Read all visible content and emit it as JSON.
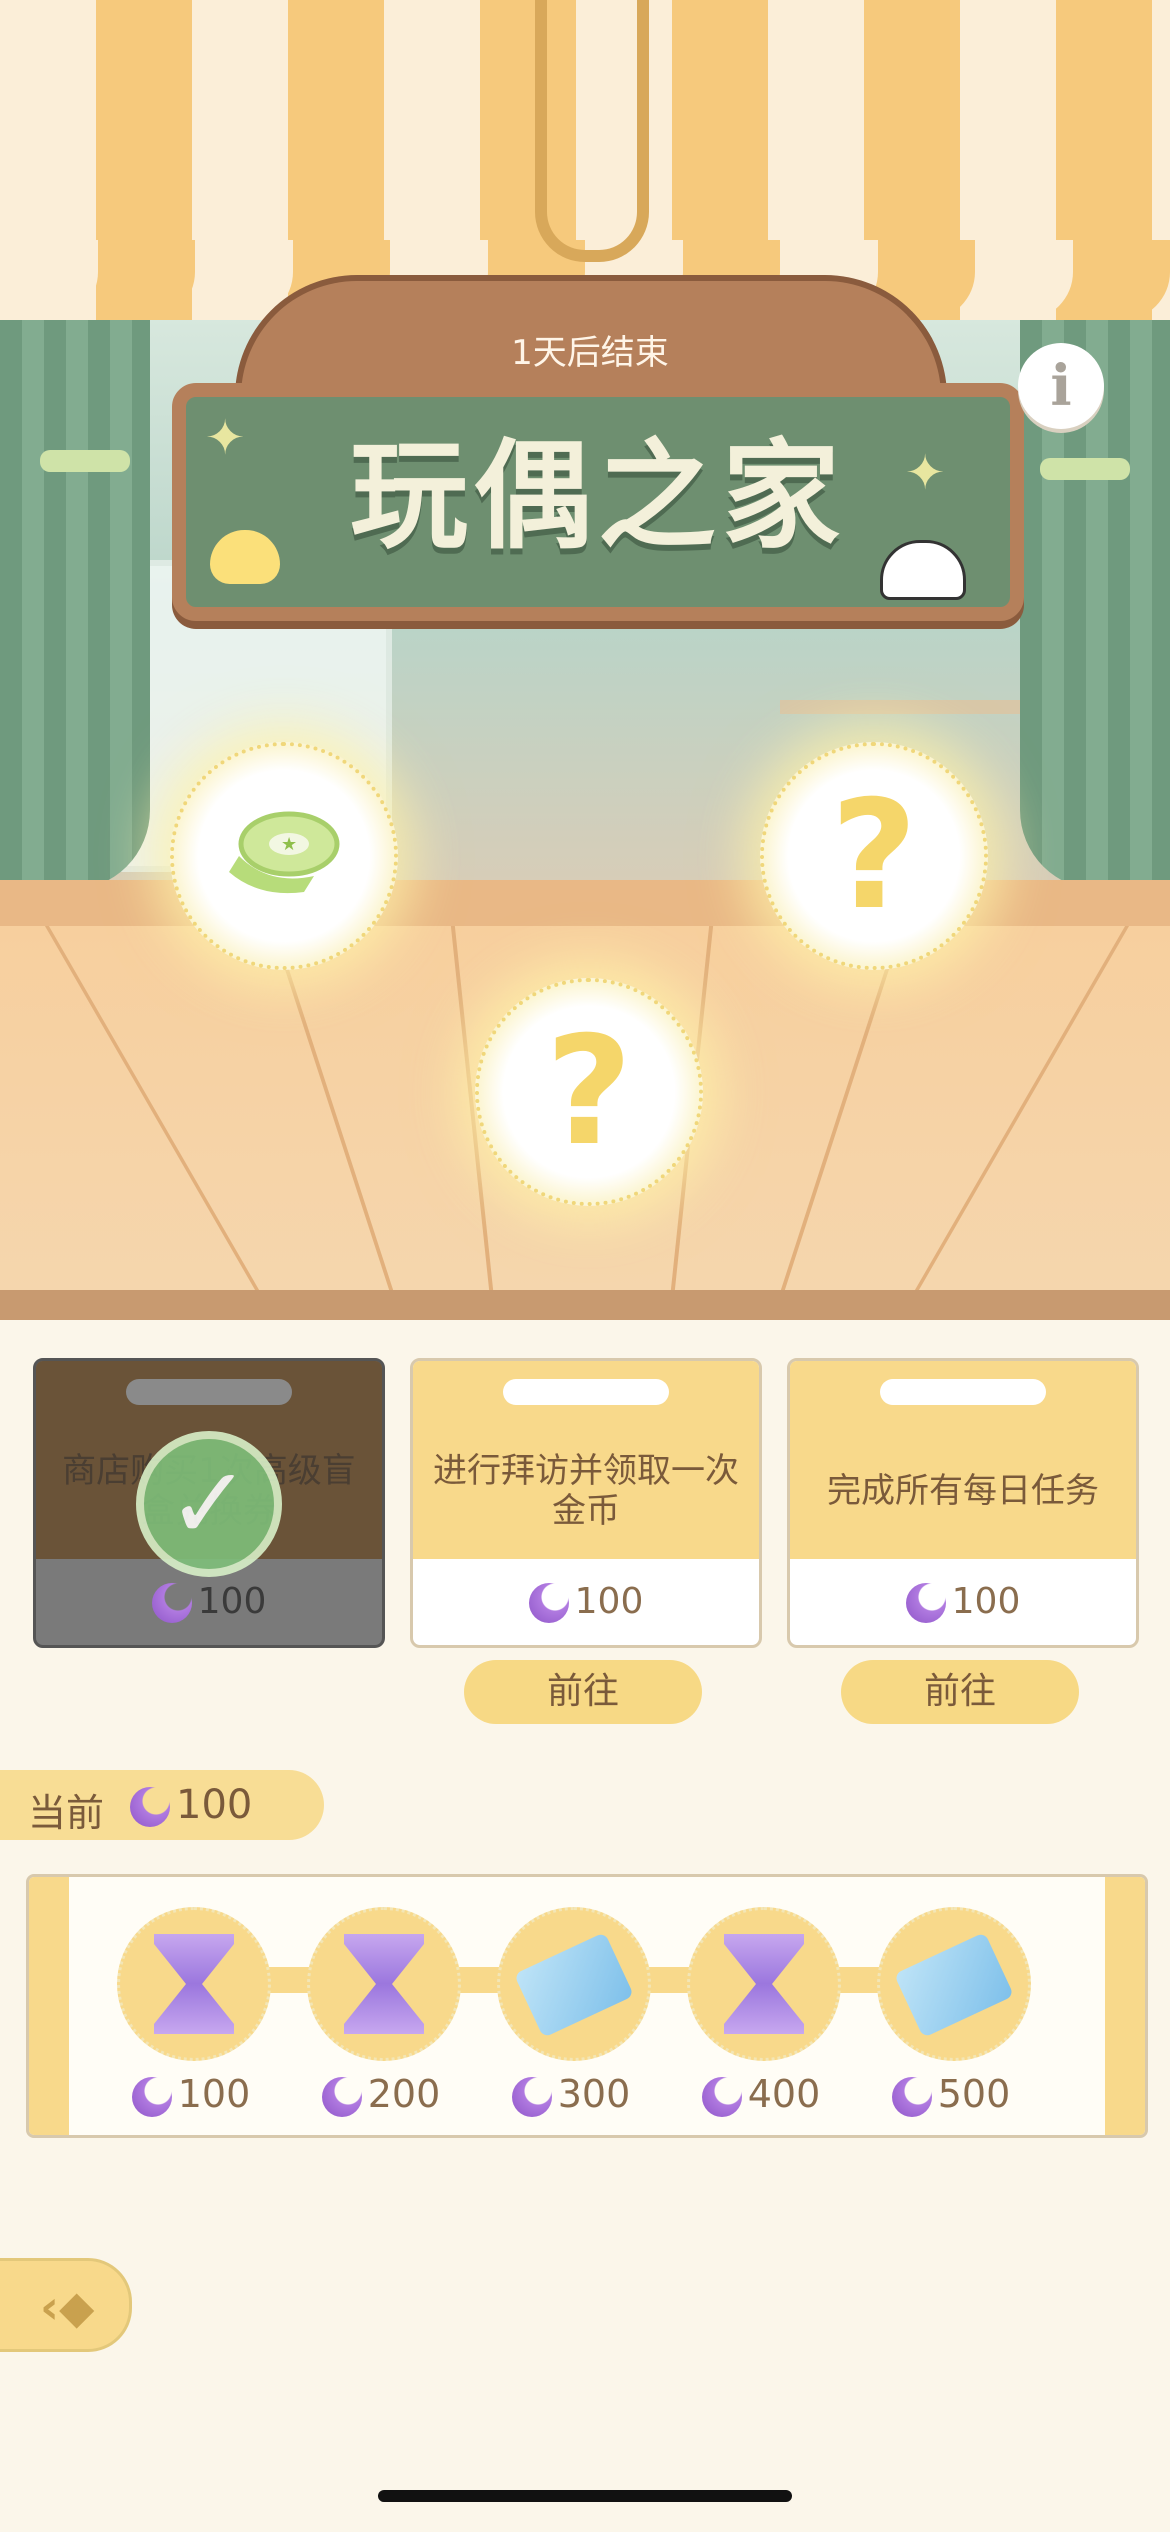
{
  "event": {
    "timer": "1天后结束",
    "title": "玩偶之家"
  },
  "prizes": [
    {
      "name": "ribbon-prize",
      "state": "revealed",
      "glyph": ""
    },
    {
      "name": "mystery-prize",
      "state": "hidden",
      "glyph": "?"
    },
    {
      "name": "mystery-prize",
      "state": "hidden",
      "glyph": "?"
    }
  ],
  "tasks": [
    {
      "text": "商店购买1次高级盲盒兑换券",
      "reward": "100",
      "status": "completed",
      "go_label": ""
    },
    {
      "text": "进行拜访并领取一次金币",
      "reward": "100",
      "status": "pending",
      "go_label": "前往"
    },
    {
      "text": "完成所有每日任务",
      "reward": "100",
      "status": "pending",
      "go_label": "前往"
    }
  ],
  "current": {
    "label": "当前",
    "value": "100"
  },
  "milestones": [
    {
      "item": "hourglass",
      "cost": "100"
    },
    {
      "item": "hourglass",
      "cost": "200"
    },
    {
      "item": "ticket",
      "cost": "300"
    },
    {
      "item": "hourglass",
      "cost": "400"
    },
    {
      "item": "ticket",
      "cost": "500"
    }
  ],
  "colors": {
    "accent_yellow": "#f8d98b",
    "moon_purple": "#9b66d6",
    "text_brown": "#7a5a3a",
    "sign_green": "#6e8f70"
  },
  "icons": {
    "info": "info-icon",
    "back": "back-arrow-icon",
    "check": "check-icon",
    "currency": "moon-icon"
  }
}
